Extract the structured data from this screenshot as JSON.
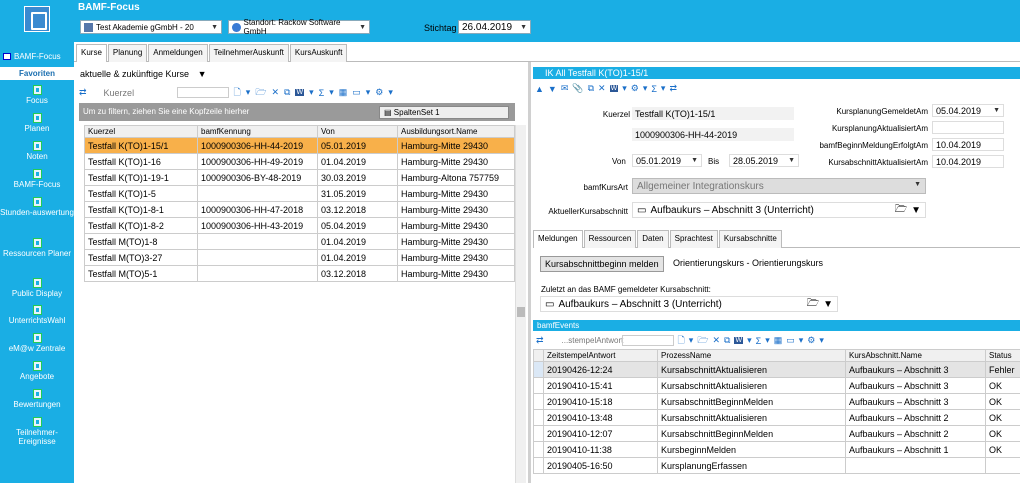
{
  "app": {
    "title": "BAMF-Focus"
  },
  "sidebar": {
    "app_label": "BAMF-Focus",
    "favorites": "Favoriten",
    "items": [
      "Focus",
      "Planen",
      "Noten",
      "BAMF-Focus",
      "Stunden-auswertung",
      "Ressourcen Planer",
      "Public Display",
      "UnterrichtsWahl",
      "eM@w Zentrale",
      "Angebote",
      "Bewertungen",
      "Teilnehmer-Ereignisse"
    ]
  },
  "topbar": {
    "company": "Test Akademie gGmbH - 20",
    "location": "Standort: Rackow Software GmbH",
    "stichtag_label": "Stichtag",
    "stichtag_value": "26.04.2019"
  },
  "tabs": [
    "Kurse",
    "Planung",
    "Anmeldungen",
    "TeilnehmerAuskunft",
    "KursAuskunft"
  ],
  "left": {
    "filter": "aktuelle & zukünftige Kurse",
    "search_label": "Kuerzel",
    "group_hint": "Um zu filtern, ziehen Sie eine Kopfzeile hierher",
    "spaltenset": "SpaltenSet 1",
    "columns": [
      "Kuerzel",
      "bamfKennung",
      "Von",
      "Ausbildungsort.Name"
    ],
    "rows": [
      [
        "Testfall K(TO)1-15/1",
        "1000900306-HH-44-2019",
        "05.01.2019",
        "Hamburg-Mitte 29430"
      ],
      [
        "Testfall K(TO)1-16",
        "1000900306-HH-49-2019",
        "01.04.2019",
        "Hamburg-Mitte 29430"
      ],
      [
        "Testfall K(TO)1-19-1",
        "1000900306-BY-48-2019",
        "30.03.2019",
        "Hamburg-Altona 757759"
      ],
      [
        "Testfall K(TO)1-5",
        "",
        "31.05.2019",
        "Hamburg-Mitte 29430"
      ],
      [
        "Testfall K(TO)1-8-1",
        "1000900306-HH-47-2018",
        "03.12.2018",
        "Hamburg-Mitte 29430"
      ],
      [
        "Testfall K(TO)1-8-2",
        "1000900306-HH-43-2019",
        "05.04.2019",
        "Hamburg-Mitte 29430"
      ],
      [
        "Testfall M(TO)1-8",
        "",
        "01.04.2019",
        "Hamburg-Mitte 29430"
      ],
      [
        "Testfall M(TO)3-27",
        "",
        "01.04.2019",
        "Hamburg-Mitte 29430"
      ],
      [
        "Testfall M(TO)5-1",
        "",
        "03.12.2018",
        "Hamburg-Mitte 29430"
      ]
    ]
  },
  "detail": {
    "title": "IK All Testfall K(TO)1-15/1",
    "kuerzel_label": "Kuerzel",
    "kuerzel": "Testfall K(TO)1-15/1",
    "kennung": "1000900306-HH-44-2019",
    "von_label": "Von",
    "von": "05.01.2019",
    "bis_label": "Bis",
    "bis": "28.05.2019",
    "kursart_label": "bamfKursArt",
    "kursart": "Allgemeiner Integrationskurs",
    "abschnitt_label": "AktuellerKursabschnitt",
    "abschnitt": "Aufbaukurs – Abschnitt 3 (Unterricht)",
    "r1_label": "KursplanungGemeldetAm",
    "r1": "05.04.2019",
    "r2_label": "KursplanungAktualisiertAm",
    "r2": "",
    "r3_label": "bamfBeginnMeldungErfolgtAm",
    "r3": "10.04.2019",
    "r4_label": "KursabschnittAktualisiertAm",
    "r4": "10.04.2019"
  },
  "subtabs": [
    "Meldungen",
    "Ressourcen",
    "Daten",
    "Sprachtest",
    "Kursabschnitte"
  ],
  "meldungen": {
    "button": "Kursabschnittbeginn melden",
    "kurs_text": "Orientierungskurs - Orientierungskurs",
    "last_label": "Zuletzt an das BAMF gemeldeter Kursabschnitt:",
    "last_value": "Aufbaukurs – Abschnitt 3 (Unterricht)"
  },
  "events": {
    "title": "bamfEvents",
    "search": "...stempelAntwort",
    "columns": [
      "ZeitstempelAntwort",
      "ProzessName",
      "KursAbschnitt.Name",
      "Status"
    ],
    "rows": [
      [
        "20190426-12:24",
        "KursabschnittAktualisieren",
        "Aufbaukurs – Abschnitt 3",
        "Fehler"
      ],
      [
        "20190410-15:41",
        "KursabschnittAktualisieren",
        "Aufbaukurs – Abschnitt 3",
        "OK"
      ],
      [
        "20190410-15:18",
        "KursabschnittBeginnMelden",
        "Aufbaukurs – Abschnitt 3",
        "OK"
      ],
      [
        "20190410-13:48",
        "KursabschnittAktualisieren",
        "Aufbaukurs – Abschnitt 2",
        "OK"
      ],
      [
        "20190410-12:07",
        "KursabschnittBeginnMelden",
        "Aufbaukurs – Abschnitt 2",
        "OK"
      ],
      [
        "20190410-11:38",
        "KursbeginnMelden",
        "Aufbaukurs – Abschnitt 1",
        "OK"
      ],
      [
        "20190405-16:50",
        "KursplanungErfassen",
        "",
        ""
      ]
    ]
  }
}
